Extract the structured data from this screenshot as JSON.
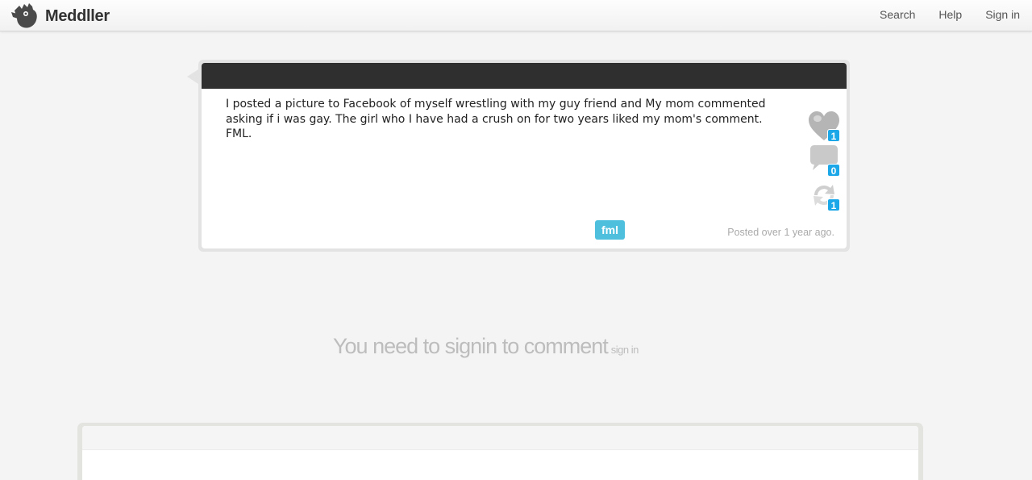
{
  "header": {
    "brand": "Meddller",
    "nav": [
      {
        "label": "Search"
      },
      {
        "label": "Help"
      },
      {
        "label": "Sign in"
      }
    ]
  },
  "post": {
    "text": "I posted a picture to Facebook of myself wrestling with my guy friend and My mom commented asking if i was gay. The girl who I have had a crush on for two years liked my mom's comment. FML.",
    "actions": {
      "like_count": "1",
      "comment_count": "0",
      "reshare_count": "1"
    },
    "tag": "fml",
    "posted": "Posted over 1 year ago."
  },
  "signin_prompt": {
    "message": "You need to signin to comment",
    "link": "sign in"
  },
  "colors": {
    "badge": "#1ba7e8",
    "tag": "#4ec0de",
    "post_header": "#2f2f2f"
  }
}
